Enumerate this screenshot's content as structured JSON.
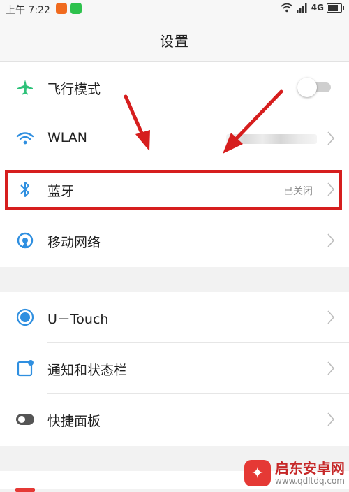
{
  "statusbar": {
    "time": "上午 7:22",
    "network": "4G"
  },
  "header": {
    "title": "设置"
  },
  "group1": [
    {
      "label": "飞行模式",
      "icon": "airplane-icon",
      "control": "toggle",
      "toggle_on": false
    },
    {
      "label": "WLAN",
      "icon": "wifi-icon",
      "status": ""
    },
    {
      "label": "蓝牙",
      "icon": "bluetooth-icon",
      "status": "已关闭"
    },
    {
      "label": "移动网络",
      "icon": "mobile-network-icon"
    }
  ],
  "group2": [
    {
      "label": "U－Touch",
      "icon": "utouch-icon"
    },
    {
      "label": "通知和状态栏",
      "icon": "notification-icon"
    },
    {
      "label": "快捷面板",
      "icon": "quick-panel-icon"
    }
  ],
  "watermark": {
    "brand": "启东安卓网",
    "url": "www.qdltdq.com"
  },
  "colors": {
    "accent": "#2f8fe0",
    "airplane": "#2ec27a",
    "highlight": "#d61e1e"
  }
}
